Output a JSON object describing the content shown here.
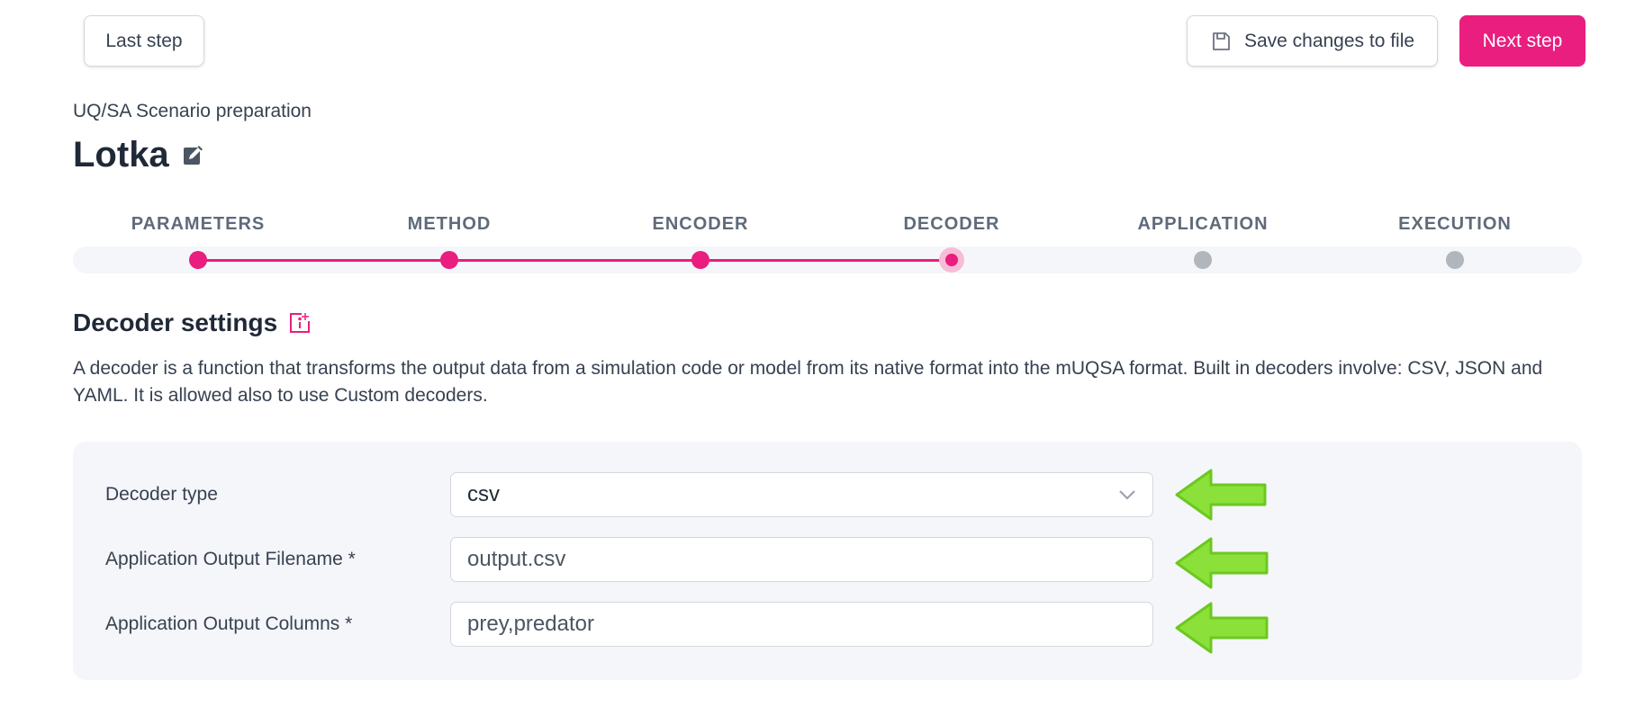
{
  "toolbar": {
    "last_step_label": "Last step",
    "save_label": "Save changes to file",
    "next_step_label": "Next step"
  },
  "header": {
    "subtitle": "UQ/SA Scenario preparation",
    "title": "Lotka"
  },
  "stepper": {
    "steps": [
      {
        "label": "PARAMETERS",
        "state": "done"
      },
      {
        "label": "METHOD",
        "state": "done"
      },
      {
        "label": "ENCODER",
        "state": "done"
      },
      {
        "label": "DECODER",
        "state": "current"
      },
      {
        "label": "APPLICATION",
        "state": "pending"
      },
      {
        "label": "EXECUTION",
        "state": "pending"
      }
    ]
  },
  "section": {
    "title": "Decoder settings",
    "description": "A decoder is a function that transforms the output data from a simulation code or model from its native format into the mUQSA format. Built in decoders involve: CSV, JSON and YAML. It is allowed also to use Custom decoders."
  },
  "form": {
    "decoder_type_label": "Decoder type",
    "decoder_type_value": "csv",
    "output_filename_label": "Application Output Filename *",
    "output_filename_value": "output.csv",
    "output_columns_label": "Application Output Columns *",
    "output_columns_value": "prey,predator"
  },
  "colors": {
    "accent": "#e91e7f",
    "pending": "#b1b5bc",
    "annotation_arrow": "#7ed321"
  },
  "icons": {
    "save": "floppy-disk-icon",
    "edit": "edit-icon",
    "info": "info-icon",
    "dropdown": "chevron-down-icon",
    "annotation": "green-arrow-icon"
  }
}
